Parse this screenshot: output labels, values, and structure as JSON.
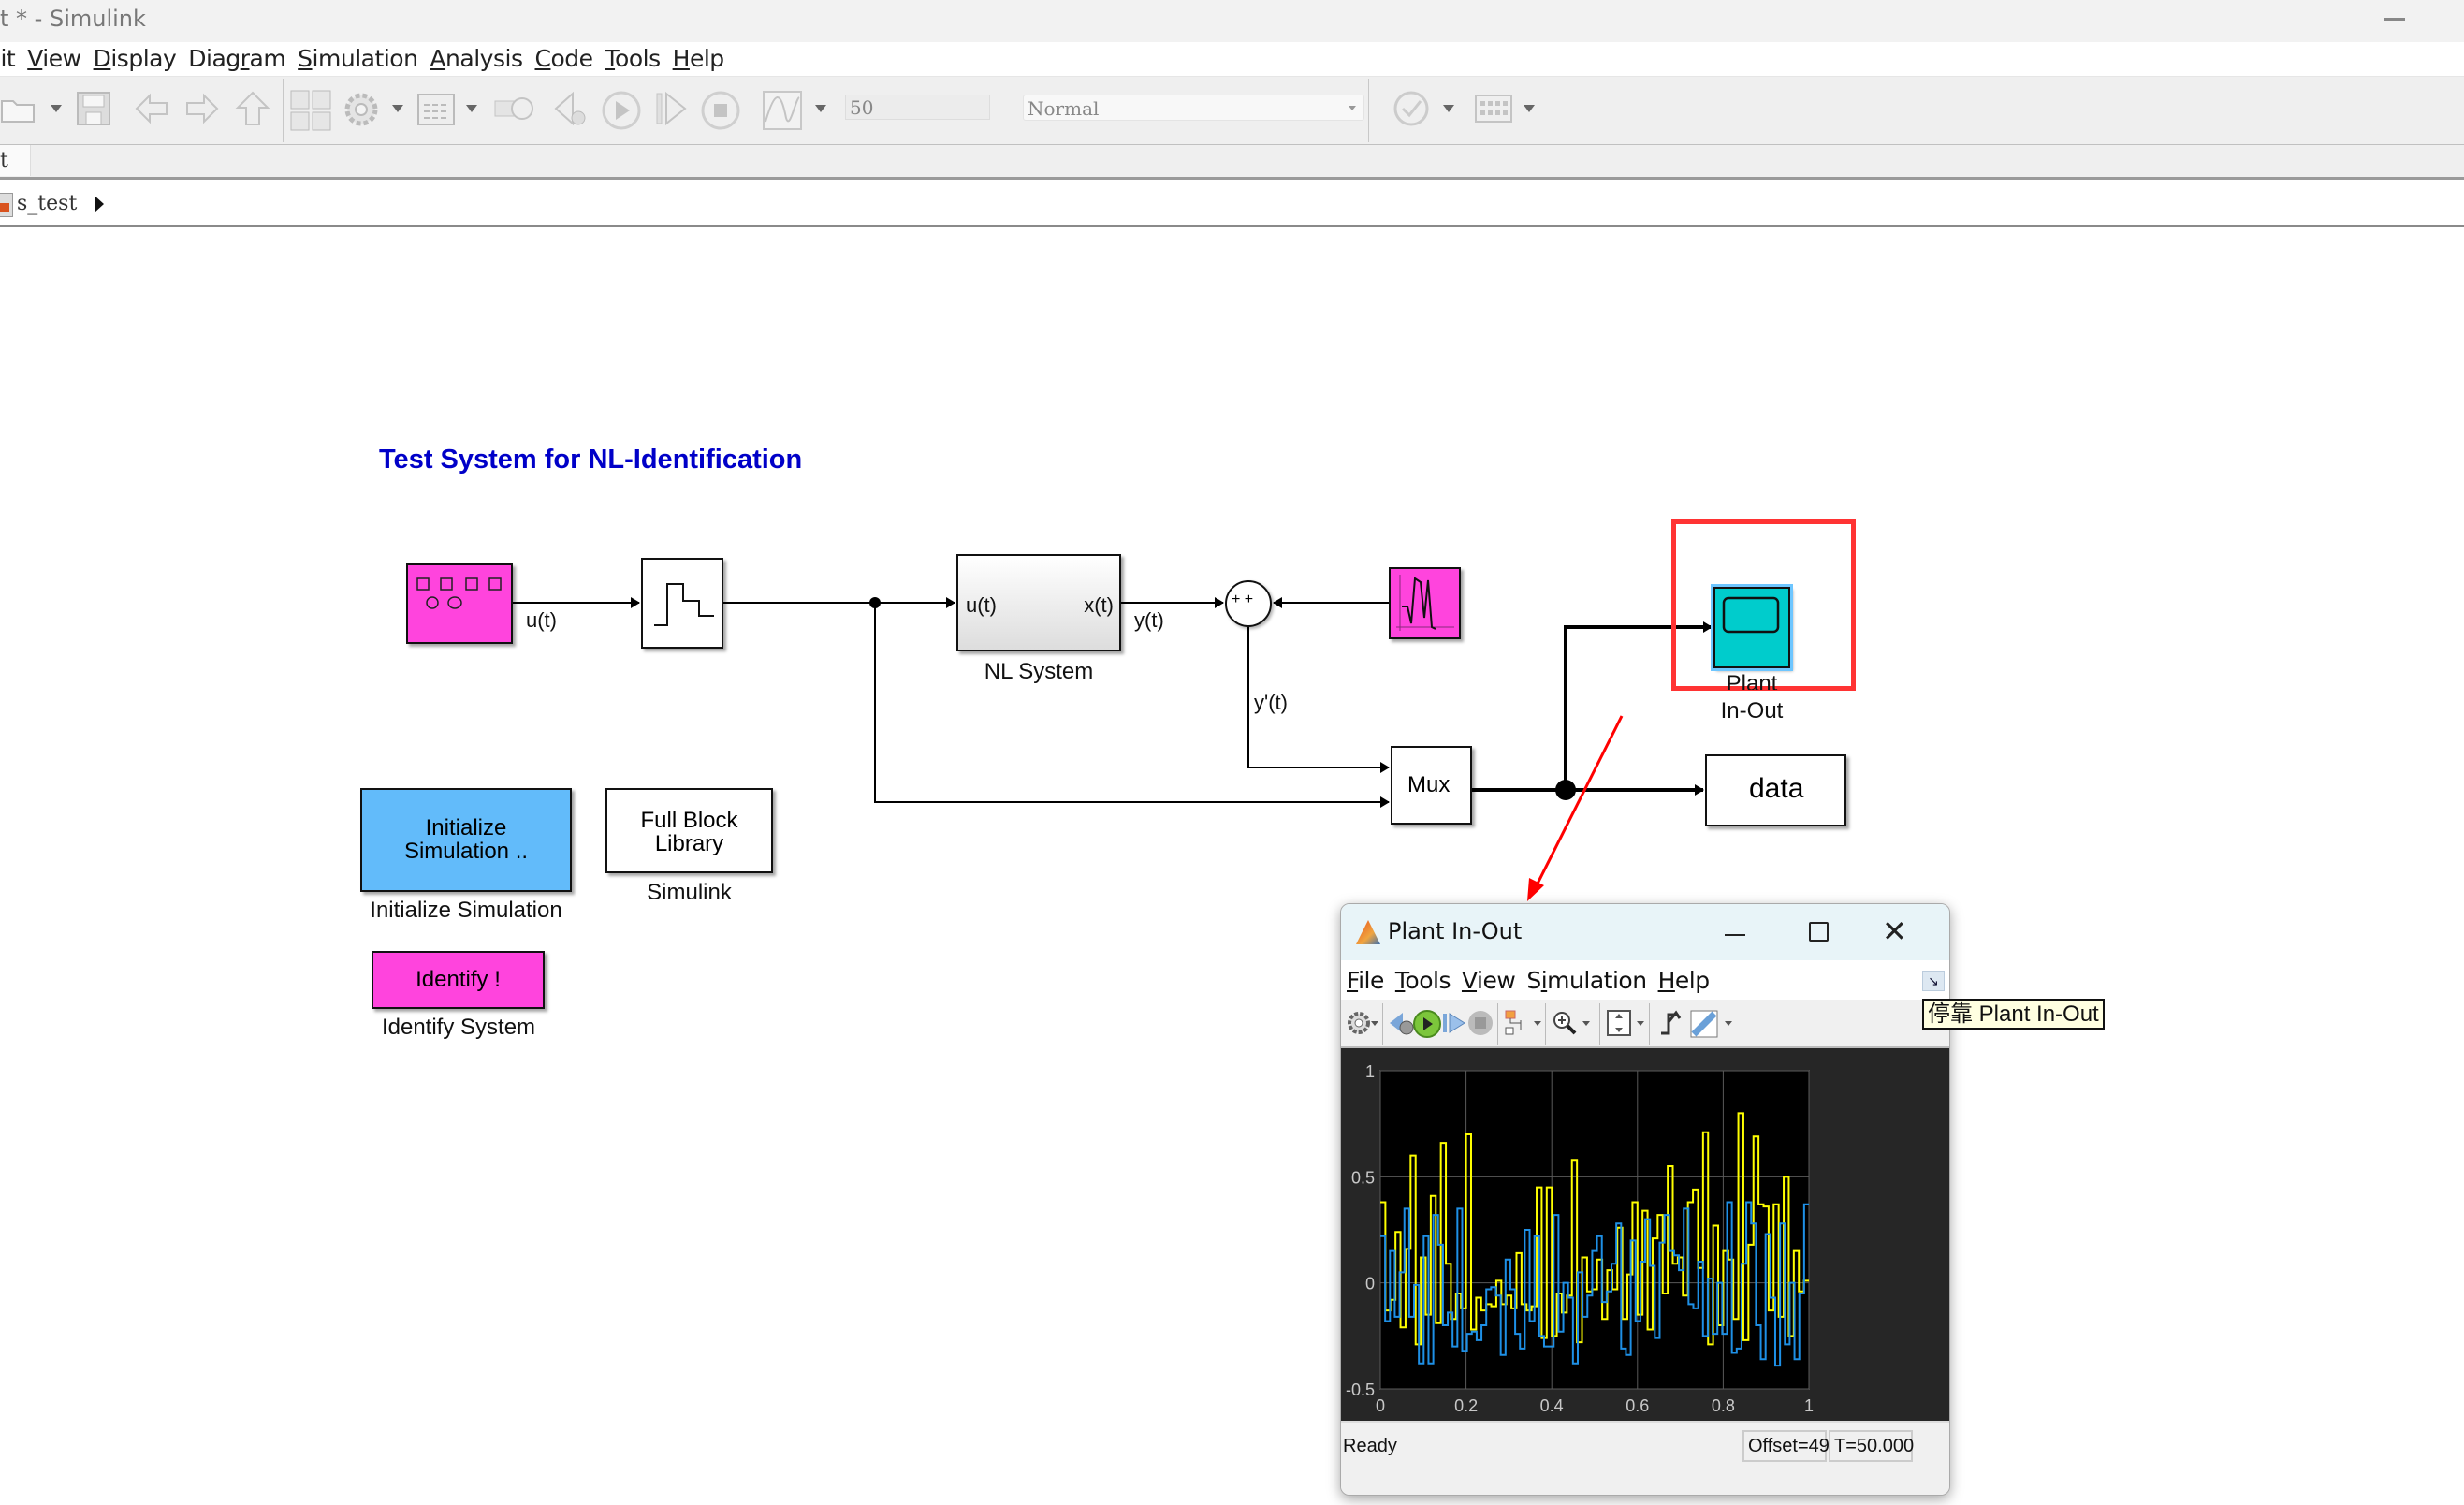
{
  "window": {
    "title": "t * - Simulink"
  },
  "menubar": {
    "items": [
      {
        "label": "lit",
        "underline_index": -1
      },
      {
        "label": "View",
        "underline_index": 0
      },
      {
        "label": "Display",
        "underline_index": 0
      },
      {
        "label": "Diagram",
        "underline_index": 4
      },
      {
        "label": "Simulation",
        "underline_index": 0
      },
      {
        "label": "Analysis",
        "underline_index": 0
      },
      {
        "label": "Code",
        "underline_index": 0
      },
      {
        "label": "Tools",
        "underline_index": 0
      },
      {
        "label": "Help",
        "underline_index": 0
      }
    ]
  },
  "toolbar": {
    "icons": [
      "open-folder-icon",
      "save-icon",
      "back-arrow-icon",
      "forward-arrow-icon",
      "up-arrow-icon",
      "library-browser-icon",
      "model-config-gear-icon",
      "model-explorer-icon",
      "step-back-config-icon",
      "step-back-icon",
      "run-icon",
      "step-forward-icon",
      "stop-icon",
      "record-data-inspector-icon",
      "check-model-icon",
      "build-icon"
    ],
    "stop_time": "50",
    "sim_mode": "Normal"
  },
  "tabs": {
    "active": "t"
  },
  "breadcrumb": {
    "model": "s_test"
  },
  "diagram": {
    "title": "Test System for NL-Identification",
    "blocks": {
      "source": {
        "label": "",
        "color": "#ff44dd"
      },
      "zoh": {
        "label": ""
      },
      "nl_system": {
        "label": "NL System",
        "in_port": "u(t)",
        "out_port": "x(t)"
      },
      "sum": {
        "signs": "+ +"
      },
      "noise": {
        "label": "",
        "color": "#ff44dd"
      },
      "scope": {
        "label_line1": "Plant",
        "label_line2": "In-Out",
        "color": "#00cccc"
      },
      "mux": {
        "label": "Mux"
      },
      "data": {
        "label": "data"
      },
      "init": {
        "text_line1": "Initialize",
        "text_line2": "Simulation ..",
        "label": "Initialize Simulation",
        "color": "#62bbfa"
      },
      "library": {
        "text_line1": "Full Block",
        "text_line2": "Library",
        "label": "Simulink"
      },
      "identify": {
        "text": "Identify !",
        "label": "Identify System",
        "color": "#ff44dd"
      }
    },
    "signals": {
      "u": "u(t)",
      "y": "y(t)",
      "yprime": "y'(t)"
    },
    "highlight_color": "#ff3333"
  },
  "scope_window": {
    "title": "Plant In-Out",
    "menu": [
      {
        "label": "File",
        "underline_index": 0
      },
      {
        "label": "Tools",
        "underline_index": 0
      },
      {
        "label": "View",
        "underline_index": 0
      },
      {
        "label": "Simulation",
        "underline_index": 1
      },
      {
        "label": "Help",
        "underline_index": 0
      }
    ],
    "toolbar_icons": [
      "settings-gear-icon",
      "step-back-icon",
      "run-icon",
      "step-forward-icon",
      "stop-icon",
      "signal-selector-icon",
      "zoom-in-icon",
      "autoscale-icon",
      "triggers-icon",
      "measurements-ruler-icon"
    ],
    "status": "Ready",
    "offset": "Offset=49",
    "time": "T=50.000",
    "tooltip": "停靠 Plant In-Out"
  },
  "chart_data": {
    "type": "line",
    "title": "",
    "xlabel": "",
    "ylabel": "",
    "xlim": [
      0,
      1
    ],
    "ylim": [
      -0.5,
      1
    ],
    "xticks": [
      "0",
      "0.2",
      "0.4",
      "0.6",
      "0.8",
      "1"
    ],
    "yticks": [
      "1",
      "0.5",
      "0",
      "-0.5"
    ],
    "grid": true,
    "step": 0.0125,
    "series": [
      {
        "name": "u(t)",
        "color": "#ffff00",
        "values": [
          0.38,
          -0.13,
          -0.08,
          0.24,
          -0.21,
          0.16,
          0.6,
          -0.29,
          0.12,
          -0.15,
          0.41,
          -0.19,
          0.66,
          0.09,
          -0.17,
          -0.05,
          -0.12,
          0.7,
          -0.22,
          -0.07,
          -0.13,
          -0.1,
          -0.11,
          0.01,
          -0.1,
          -0.06,
          -0.12,
          0.14,
          -0.1,
          -0.13,
          -0.11,
          0.45,
          -0.26,
          0.45,
          -0.25,
          -0.05,
          -0.14,
          -0.06,
          0.58,
          -0.28,
          0.12,
          -0.04,
          -0.03,
          0.11,
          -0.17,
          0.06,
          -0.03,
          0.26,
          -0.17,
          0.04,
          0.38,
          -0.15,
          0.34,
          -0.22,
          0.21,
          0.32,
          -0.05,
          0.55,
          0.09,
          0.12,
          -0.06,
          0.38,
          0.44,
          0.07,
          0.71,
          -0.29,
          0.27,
          -0.2,
          0.15,
          0.11,
          -0.17,
          0.8,
          -0.27,
          0.18,
          0.69,
          0.37,
          0.36,
          -0.13,
          0.37,
          -0.16,
          0.5,
          -0.25,
          0.15,
          -0.04,
          0.01
        ]
      },
      {
        "name": "y'(t)",
        "color": "#1e90e6",
        "values": [
          0.22,
          -0.18,
          0.15,
          -0.16,
          0.05,
          0.35,
          -0.16,
          -0.01,
          -0.38,
          0.22,
          -0.38,
          0.32,
          0.18,
          -0.2,
          -0.14,
          -0.3,
          0.35,
          -0.32,
          -0.24,
          -0.23,
          -0.27,
          -0.2,
          -0.03,
          -0.02,
          -0.06,
          -0.34,
          0.11,
          -0.03,
          -0.24,
          -0.31,
          0.25,
          -0.18,
          0.22,
          -0.25,
          -0.3,
          -0.3,
          0.32,
          -0.23,
          0.0,
          -0.07,
          -0.38,
          0.05,
          -0.16,
          -0.06,
          0.15,
          0.22,
          -0.09,
          -0.04,
          0.09,
          0.28,
          -0.31,
          -0.34,
          0.2,
          -0.18,
          0.1,
          0.3,
          0.08,
          -0.26,
          0.19,
          0.32,
          0.15,
          0.13,
          0.06,
          0.35,
          -0.1,
          -0.12,
          0.1,
          -0.25,
          0.02,
          -0.24,
          0.0,
          -0.24,
          0.38,
          -0.33,
          -0.31,
          0.09,
          0.38,
          0.28,
          -0.2,
          -0.36,
          0.23,
          -0.07,
          -0.39,
          0.28,
          -0.29,
          0.0,
          -0.36,
          -0.05,
          0.37
        ]
      }
    ]
  }
}
